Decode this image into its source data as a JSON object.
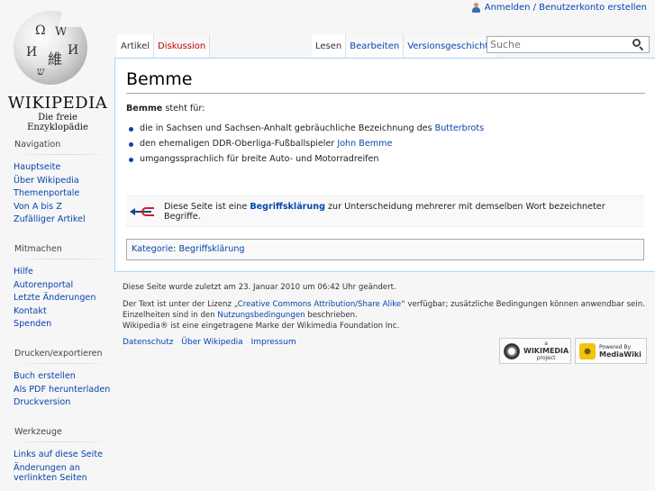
{
  "personal": {
    "login_label": "Anmelden / Benutzerkonto erstellen"
  },
  "logo": {
    "wordmark": "WIKIPEDIA",
    "tagline": "Die freie Enzyklopädie"
  },
  "sidebar": {
    "navigation": {
      "heading": "Navigation",
      "items": [
        "Hauptseite",
        "Über Wikipedia",
        "Themenportale",
        "Von A bis Z",
        "Zufälliger Artikel"
      ]
    },
    "mitmachen": {
      "heading": "Mitmachen",
      "items": [
        "Hilfe",
        "Autorenportal",
        "Letzte Änderungen",
        "Kontakt",
        "Spenden"
      ]
    },
    "drucken": {
      "heading": "Drucken/exportieren",
      "items": [
        "Buch erstellen",
        "Als PDF herunterladen",
        "Druckversion"
      ]
    },
    "werkzeuge": {
      "heading": "Werkzeuge",
      "items": [
        "Links auf diese Seite",
        "Änderungen an verlinkten Seiten"
      ]
    }
  },
  "tabs": {
    "left": [
      {
        "label": "Artikel"
      },
      {
        "label": "Diskussion"
      }
    ],
    "right": [
      {
        "label": "Lesen"
      },
      {
        "label": "Bearbeiten"
      },
      {
        "label": "Versionsgeschichte"
      }
    ]
  },
  "search": {
    "placeholder": "Suche"
  },
  "article": {
    "title": "Bemme",
    "intro_bold": "Bemme",
    "intro_rest": " steht für:",
    "items": [
      {
        "pre": "die in Sachsen und Sachsen-Anhalt gebräuchliche Bezeichnung des ",
        "link": "Butterbrots",
        "post": ""
      },
      {
        "pre": "den ehemaligen DDR-Oberliga-Fußballspieler ",
        "link": "John Bemme",
        "post": ""
      },
      {
        "pre": "umgangssprachlich für breite Auto- und Motorradreifen",
        "link": "",
        "post": ""
      }
    ],
    "disambig": {
      "pre": "Diese Seite ist eine ",
      "link": "Begriffsklärung",
      "post": " zur Unterscheidung mehrerer mit demselben Wort bezeichneter Begriffe."
    },
    "category_label": "Kategorie",
    "category_sep": ": ",
    "category_link": "Begriffsklärung"
  },
  "footer": {
    "lastmod": "Diese Seite wurde zuletzt am 23. Januar 2010 um 06:42 Uhr geändert.",
    "license_pre": "Der Text ist unter der Lizenz „",
    "license_link": "Creative Commons Attribution/Share Alike",
    "license_post": "“ verfügbar; zusätzliche Bedingungen können anwendbar sein.",
    "details_pre": "Einzelheiten sind in den ",
    "details_link": "Nutzungsbedingungen",
    "details_post": " beschrieben.",
    "trademark": "Wikipedia® ist eine eingetragene Marke der Wikimedia Foundation Inc.",
    "places": [
      "Datenschutz",
      "Über Wikipedia",
      "Impressum"
    ],
    "badge_wm": {
      "small": "a",
      "big": "WIKIMEDIA",
      "sub": "project"
    },
    "badge_mw": {
      "small": "Powered By",
      "big": "MediaWiki"
    }
  }
}
